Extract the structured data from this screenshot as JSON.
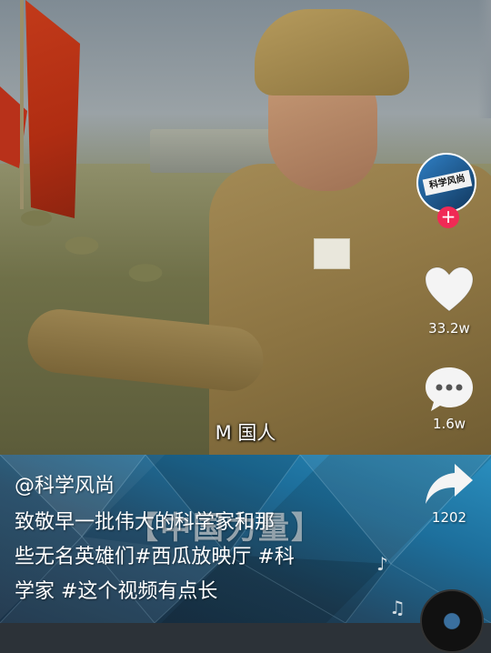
{
  "video": {
    "subtitle": "M 国人"
  },
  "overlay": {
    "watermark": "【中国力量】"
  },
  "author": {
    "handle": "@科学风尚",
    "avatar_label": "科学风尚"
  },
  "description": {
    "lines": [
      "致敬早一批伟大的科学家和那",
      "些无名英雄们#西瓜放映厅 #科",
      "学家 #这个视频有点长"
    ]
  },
  "actions": {
    "follow": "+",
    "likes": "33.2w",
    "comments": "1.6w",
    "shares": "1202"
  },
  "icons": {
    "like": "heart-icon",
    "comment": "comment-bubble-icon",
    "share": "share-arrow-icon",
    "music": "music-note-icon",
    "disc": "music-disc-icon"
  },
  "colors": {
    "follow_badge": "#f02a55",
    "panel": "#1d6f9c",
    "text": "#ffffff"
  }
}
